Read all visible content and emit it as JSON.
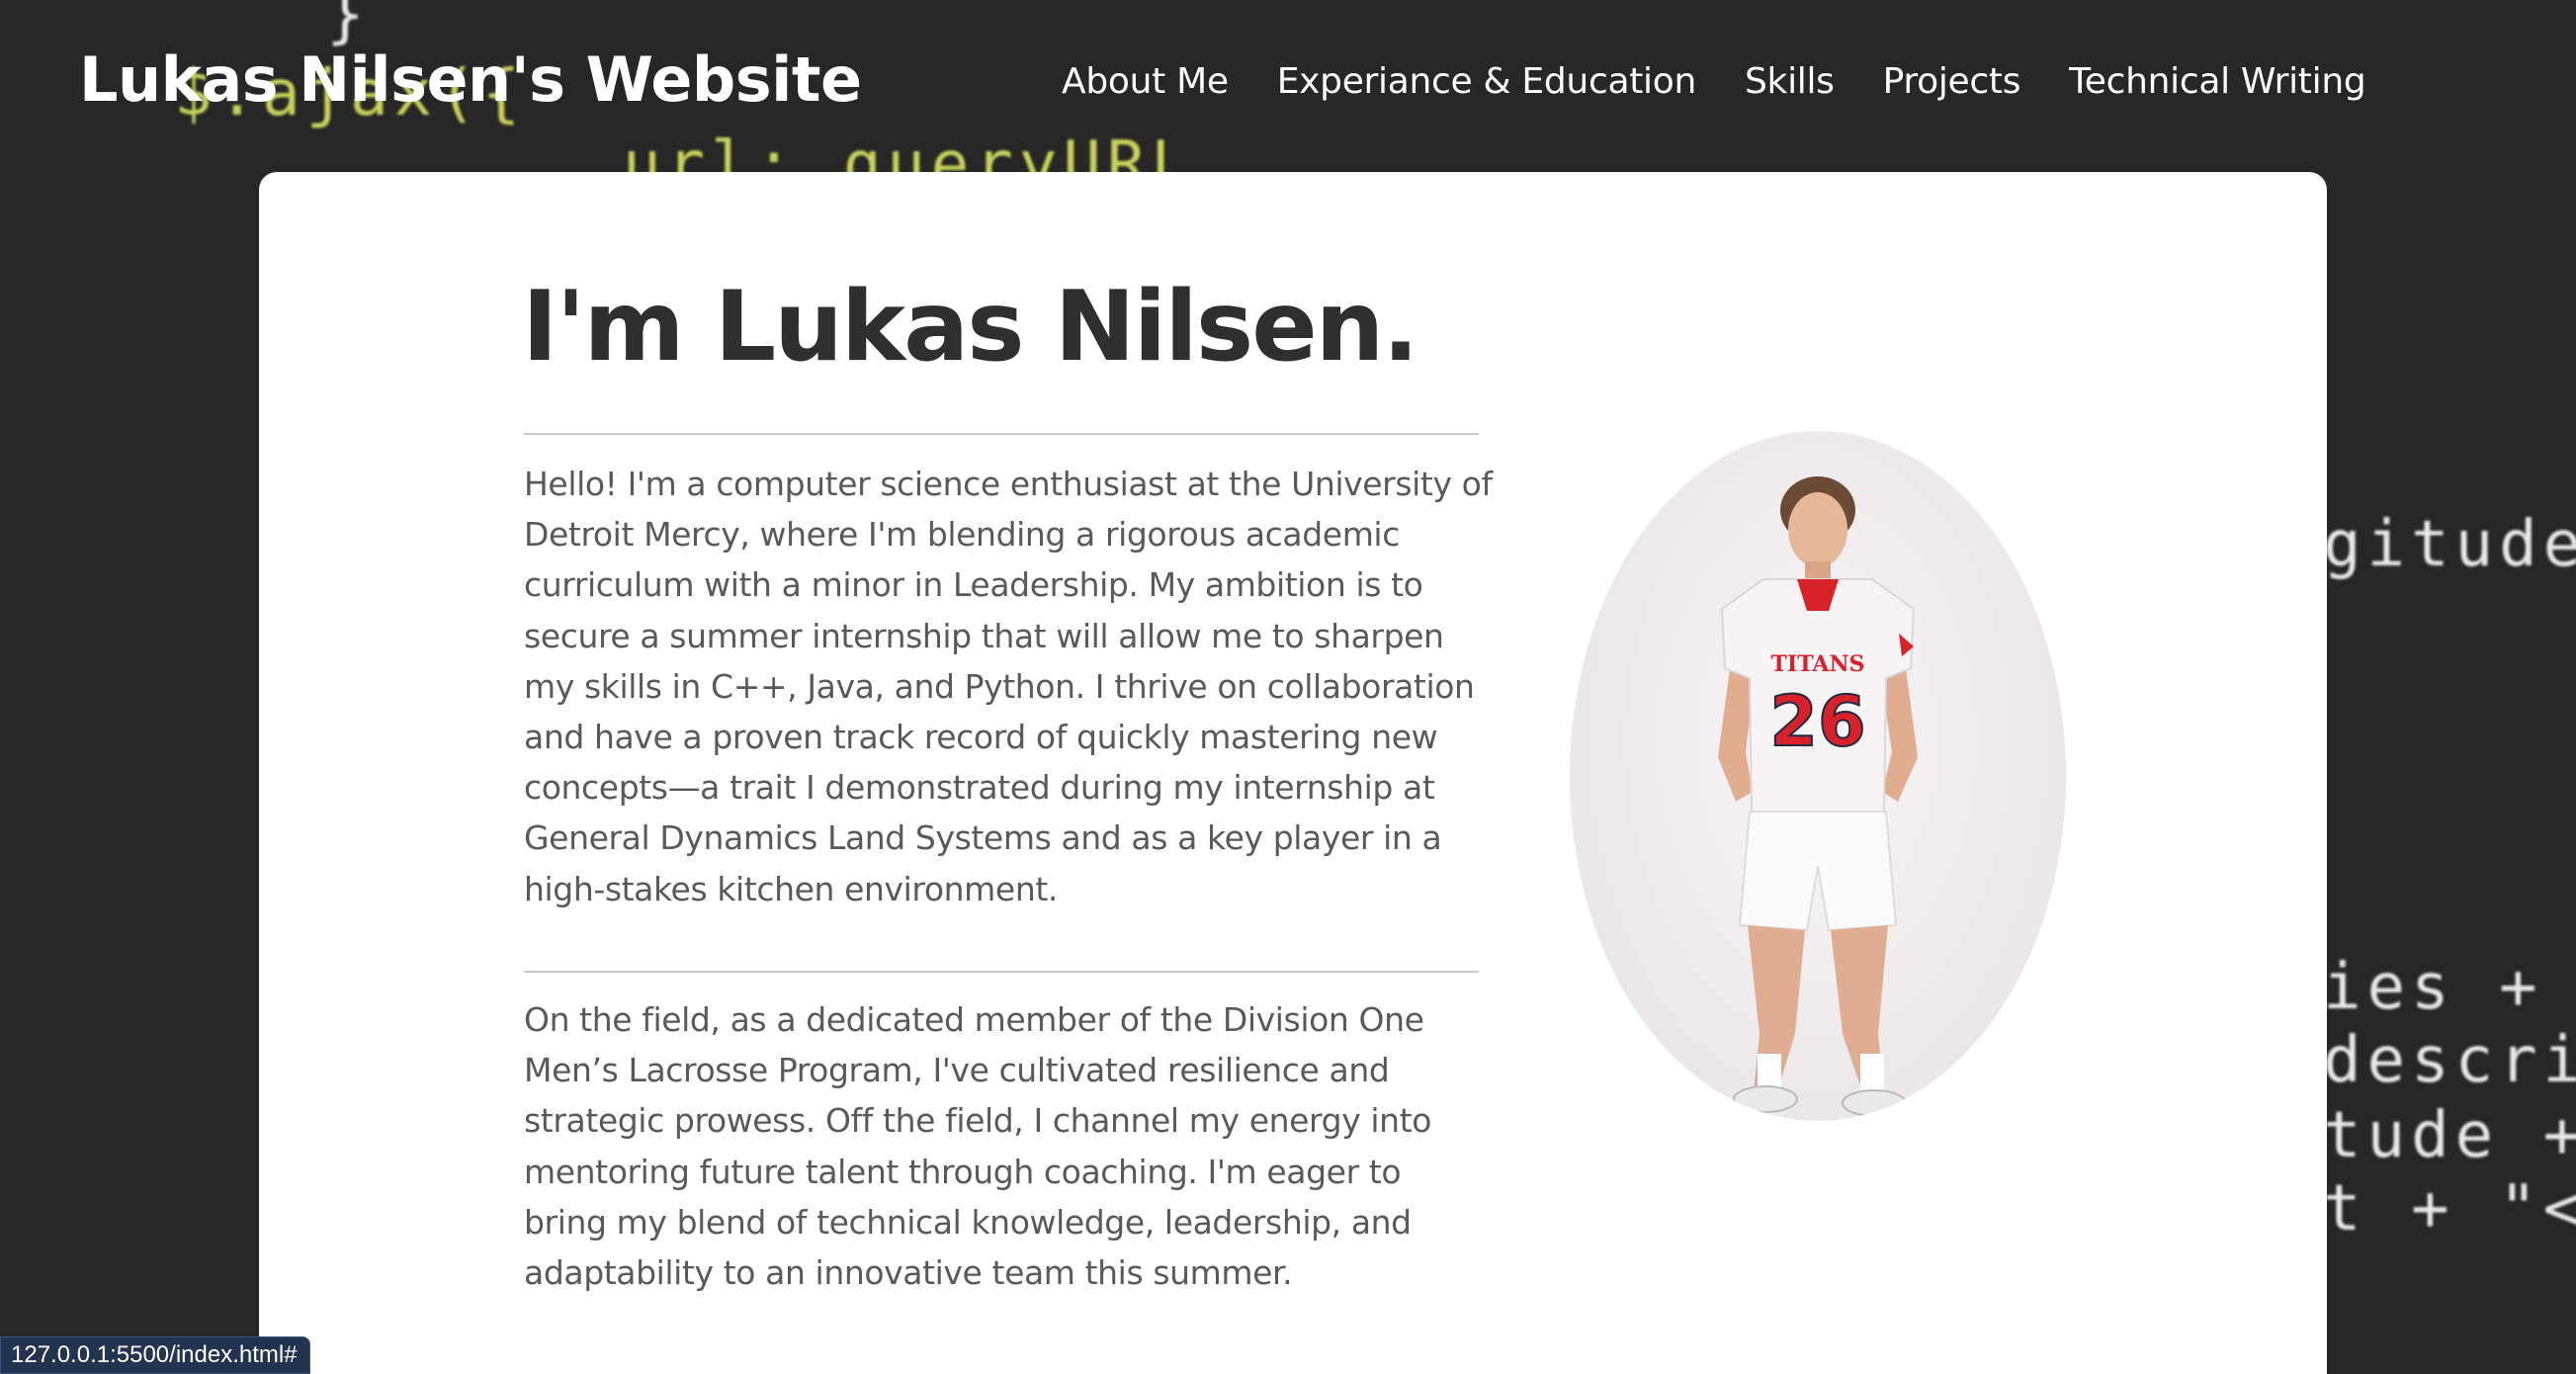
{
  "header": {
    "site_title": "Lukas Nilsen's Website",
    "nav": [
      {
        "label": "About Me"
      },
      {
        "label": "Experiance & Education"
      },
      {
        "label": "Skills"
      },
      {
        "label": "Projects"
      },
      {
        "label": "Technical Writing"
      }
    ]
  },
  "main": {
    "headline": "I'm Lukas Nilsen.",
    "paragraphs": [
      "Hello! I'm a computer science enthusiast at the University of Detroit Mercy, where I'm blending a rigorous academic curriculum with a minor in Leadership. My ambition is to secure a summer internship that will allow me to sharpen my skills in C++, Java, and Python. I thrive on collaboration and have a proven track record of quickly mastering new concepts—a trait I demonstrated during my internship at General Dynamics Land Systems and as a key player in a high-stakes kitchen environment.",
      "On the field, as a dedicated member of the Division One Men’s Lacrosse Program, I've cultivated resilience and strategic prowess. Off the field, I channel my energy into mentoring future talent through coaching. I'm eager to bring my blend of technical knowledge, leadership, and adaptability to an innovative team this summer."
    ],
    "photo": {
      "jersey_team": "TITANS",
      "jersey_number": "26"
    }
  },
  "background_code": {
    "lines": [
      "}",
      "$.ajax({",
      "url: queryURL",
      "gitude]",
      "ies + \"<",
      "descrip",
      "tude +",
      "t + \"</"
    ]
  },
  "status_bar": {
    "url": "127.0.0.1:5500/index.html#"
  },
  "colors": {
    "page_background": "#272727",
    "card_background": "#ffffff",
    "headline_text": "#2f2f2f",
    "body_text": "#595959",
    "jersey_red": "#d8222a",
    "status_bar": "#22344f"
  }
}
